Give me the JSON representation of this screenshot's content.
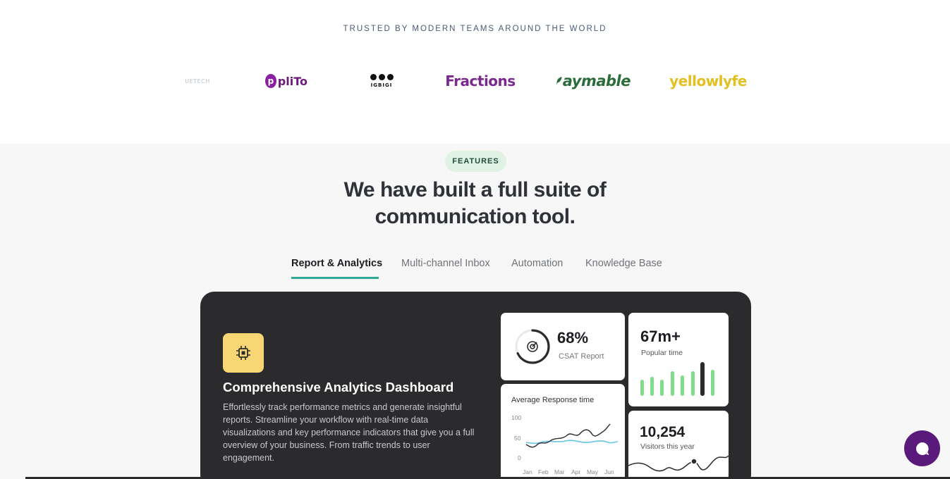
{
  "trusted": {
    "title": "TRUSTED BY MODERN TEAMS AROUND THE WORLD",
    "logos": [
      "UETECH",
      "pliTo",
      "IGBIGI",
      "Fractions",
      "aymable",
      "yellowlyfe"
    ]
  },
  "features": {
    "badge": "FEATURES",
    "headline_line1": "We have built a full suite of",
    "headline_line2": "communication tool.",
    "tabs": [
      {
        "label": "Report & Analytics",
        "active": true
      },
      {
        "label": "Multi-channel Inbox",
        "active": false
      },
      {
        "label": "Automation",
        "active": false
      },
      {
        "label": "Knowledge Base",
        "active": false
      }
    ],
    "card": {
      "icon": "chip-icon",
      "title": "Comprehensive Analytics Dashboard",
      "text": "Effortlessly track performance metrics and generate insightful reports. Streamline your workflow with real-time data visualizations and key performance indicators that give you a full overview of your business. From traffic trends to user engagement.",
      "csat": {
        "value": "68%",
        "label": "CSAT Report",
        "progress": 0.68
      },
      "popular": {
        "value": "67m+",
        "label": "Popular time"
      },
      "response": {
        "title": "Average Response time",
        "y_ticks": [
          "100",
          "50",
          "0"
        ],
        "x_ticks": [
          "Jan",
          "Feb",
          "Mar",
          "Apr",
          "May",
          "Jun"
        ]
      },
      "visitors": {
        "value": "10,254",
        "label": "Visitors this year"
      }
    }
  },
  "colors": {
    "accent": "#2ea893",
    "card_bg": "#2b2b2d",
    "chip_bg": "#f9d674",
    "bar_green": "#7fdc8a",
    "chat_button": "#5a1a7c"
  }
}
